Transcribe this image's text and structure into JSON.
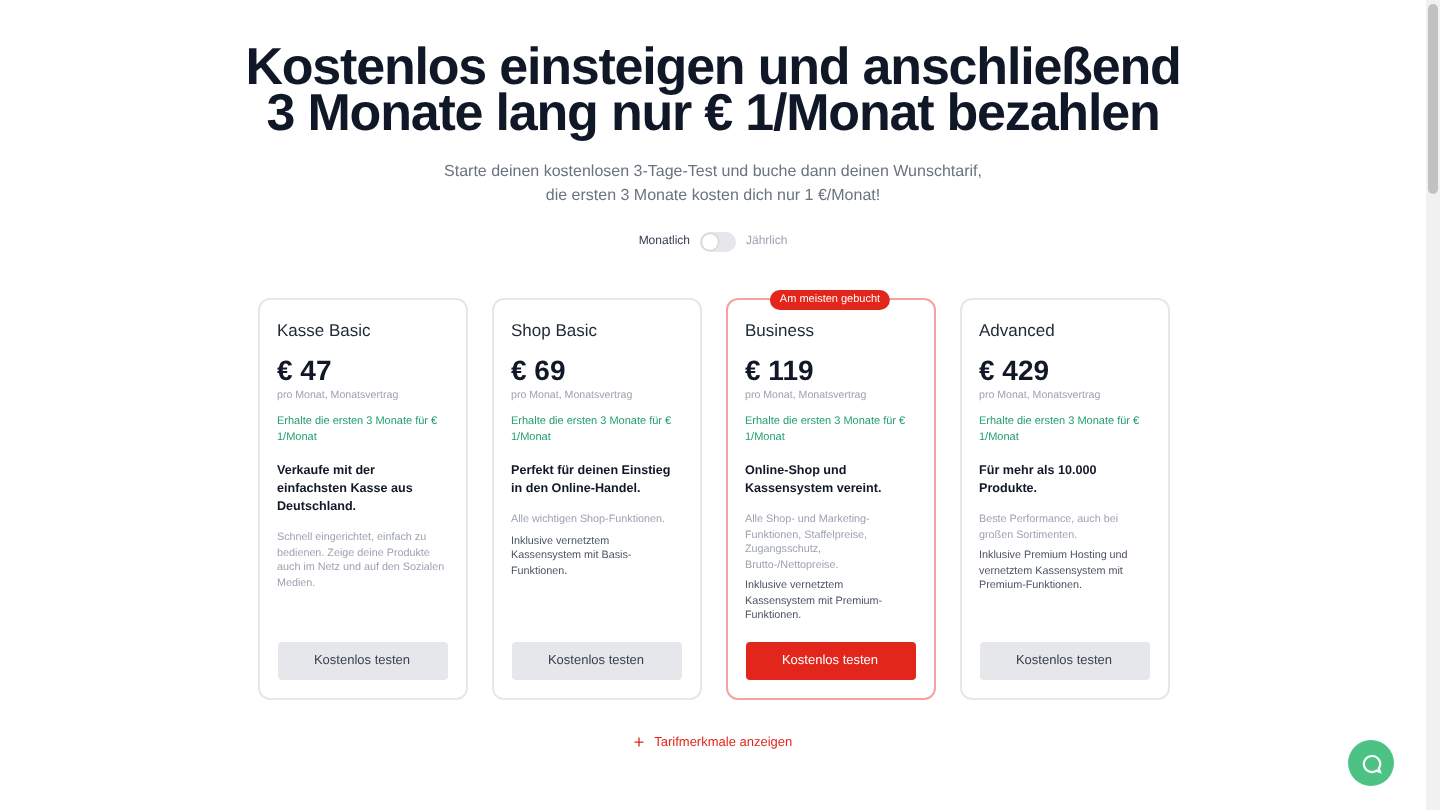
{
  "heading": {
    "lines": [
      "Kostenlos einsteigen und anschließend",
      "3 Monate lang nur € 1/Monat bezahlen"
    ],
    "subtitle": "Starte deinen kostenlosen 3-Tage-Test und buche dann deinen Wunschtarif, die ersten 3 Monate kosten dich nur 1 €/Monat!"
  },
  "billing": [
    {
      "label": "Monatlich",
      "selected": true
    },
    {
      "label": "Jährlich",
      "selected": false
    }
  ],
  "plans": [
    {
      "name": "Kasse Basic",
      "price": "€ 47",
      "period": "pro Monat, Monatsvertrag",
      "offer": "Erhalte die ersten 3 Monate für € 1/Monat",
      "tagline": "Verkaufe mit der einfachsten Kasse aus Deutschland.",
      "notes": [
        {
          "kind": "muted",
          "text": "Schnell eingerichtet, einfach zu bedienen. Zeige deine Produkte auch im Netz und auf den Sozialen Medien."
        }
      ],
      "button": "Kostenlos testen",
      "featured": false
    },
    {
      "name": "Shop Basic",
      "price": "€ 69",
      "period": "pro Monat, Monatsvertrag",
      "offer": "Erhalte die ersten 3 Monate für € 1/Monat",
      "tagline": "Perfekt für deinen Einstieg in den Online-Handel.",
      "notes": [
        {
          "kind": "muted",
          "text": "Alle wichtigen Shop-Funktionen."
        },
        {
          "kind": "normal",
          "text": "Inklusive vernetztem Kassensystem mit Basis-Funktionen."
        }
      ],
      "button": "Kostenlos testen",
      "featured": false
    },
    {
      "name": "Business",
      "price": "€ 119",
      "period": "pro Monat, Monatsvertrag",
      "offer": "Erhalte die ersten 3 Monate für € 1/Monat",
      "tagline": "Online-Shop und Kassensystem vereint.",
      "notes": [
        {
          "kind": "muted",
          "text": "Alle Shop- und Marketing-Funktionen, Staffelpreise, Zugangsschutz, Brutto-/Nettopreise."
        },
        {
          "kind": "normal",
          "text": "Inklusive vernetztem Kassensystem mit Premium-Funktionen."
        }
      ],
      "button": "Kostenlos testen",
      "featured": true,
      "badge": "Am meisten gebucht"
    },
    {
      "name": "Advanced",
      "price": "€ 429",
      "period": "pro Monat, Monatsvertrag",
      "offer": "Erhalte die ersten 3 Monate für € 1/Monat",
      "tagline": "Für mehr als 10.000 Produkte.",
      "notes": [
        {
          "kind": "muted",
          "text": "Beste Performance, auch bei großen Sortimenten."
        },
        {
          "kind": "normal",
          "text": "Inklusive Premium Hosting und vernetztem Kassensystem mit Premium-Funktionen."
        }
      ],
      "button": "Kostenlos testen",
      "featured": false
    }
  ],
  "features_link": {
    "icon": "+",
    "label": "Tarifmerkmale anzeigen"
  }
}
